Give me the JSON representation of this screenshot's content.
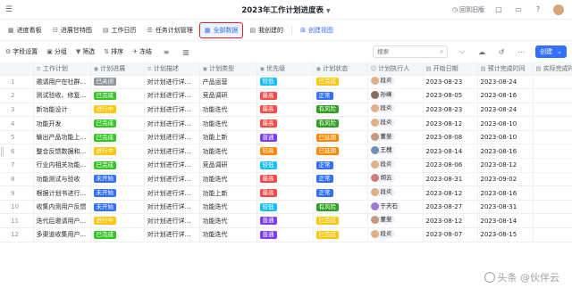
{
  "header": {
    "title": "2023年工作计划进度表",
    "back_label": "回到旧版"
  },
  "tabs": [
    {
      "label": "进度看板",
      "icon": "board-icon"
    },
    {
      "label": "进展甘特图",
      "icon": "gantt-icon"
    },
    {
      "label": "工作日历",
      "icon": "calendar-icon"
    },
    {
      "label": "任务计划管理",
      "icon": "list-icon"
    },
    {
      "label": "全部数据",
      "icon": "grid-icon",
      "active": true
    },
    {
      "label": "我创建的",
      "icon": "table-icon"
    },
    {
      "label": "创建视图",
      "icon": "plus-icon"
    }
  ],
  "toolbar": {
    "field_settings": "字段设置",
    "group": "分组",
    "filter": "筛选",
    "sort": "排序",
    "freeze": "冻结",
    "search_placeholder": "搜索",
    "create_label": "创建"
  },
  "table": {
    "columns": [
      "工作计划",
      "计划进展",
      "计划描述",
      "计划类型",
      "优先级",
      "计划状态",
      "计划执行人",
      "开始日期",
      "预计完成时间",
      "实际完成时"
    ],
    "rows": [
      {
        "idx": "1",
        "plan": "邀请用户在社群...",
        "progress": "已关闭",
        "desc": "对计划进行详细...",
        "type": "产品运营",
        "priority": "较低",
        "status": "已完成",
        "owner": "段炎",
        "start": "2023-08-23",
        "due": "2023-08-24",
        "actual": ""
      },
      {
        "idx": "2",
        "plan": "测试验收、修复...",
        "progress": "已完成",
        "desc": "对计划进行详细...",
        "type": "竞品调研",
        "priority": "最高",
        "status": "正常",
        "owner": "孙峰",
        "start": "2023-08-05",
        "due": "2023-08-16",
        "actual": ""
      },
      {
        "idx": "3",
        "plan": "新功能设计",
        "progress": "进行中",
        "desc": "对计划进行详细...",
        "type": "功能迭代",
        "priority": "最高",
        "status": "有风险",
        "owner": "段炎",
        "start": "2023-08-23",
        "due": "2023-08-24",
        "actual": ""
      },
      {
        "idx": "4",
        "plan": "功能开发",
        "progress": "已完成",
        "desc": "对计划进行详细...",
        "type": "功能迭代",
        "priority": "最高",
        "status": "有风险",
        "owner": "段炎",
        "start": "2023-08-12",
        "due": "2023-08-10",
        "actual": ""
      },
      {
        "idx": "5",
        "plan": "输出产品功能上...",
        "progress": "已完成",
        "desc": "对计划进行详细...",
        "type": "功能上新",
        "priority": "普通",
        "status": "已延期",
        "owner": "董斐",
        "start": "2023-08-08",
        "due": "2023-08-10",
        "actual": ""
      },
      {
        "idx": "6",
        "plan": "整合反馈数据和...",
        "progress": "进行中",
        "desc": "对计划进行详细...",
        "type": "功能迭代",
        "priority": "较高",
        "status": "已延期",
        "owner": "王槐",
        "start": "2023-08-14",
        "due": "2023-08-16",
        "actual": ""
      },
      {
        "idx": "7",
        "plan": "行业内相关功能...",
        "progress": "已完成",
        "desc": "对计划进行详细...",
        "type": "竞品调研",
        "priority": "较低",
        "status": "正常",
        "owner": "段炎",
        "start": "2023-08-06",
        "due": "2023-08-12",
        "actual": ""
      },
      {
        "idx": "8",
        "plan": "功能测试与验收",
        "progress": "未开始",
        "desc": "对计划进行详细...",
        "type": "功能迭代",
        "priority": "最高",
        "status": "正常",
        "owner": "胡云",
        "start": "2023-08-31",
        "due": "2023-09-02",
        "actual": ""
      },
      {
        "idx": "9",
        "plan": "根据计划书进行...",
        "progress": "未开始",
        "desc": "对计划进行详细...",
        "type": "功能上新",
        "priority": "最高",
        "status": "正常",
        "owner": "段炎",
        "start": "2023-08-12",
        "due": "2023-08-16",
        "actual": ""
      },
      {
        "idx": "10",
        "plan": "收集内测用户反馈",
        "progress": "未开始",
        "desc": "对计划进行详细...",
        "type": "功能迭代",
        "priority": "较低",
        "status": "有风险",
        "owner": "于天石",
        "start": "2023-08-27",
        "due": "2023-08-31",
        "actual": ""
      },
      {
        "idx": "11",
        "plan": "迭代后邀请用户...",
        "progress": "进行中",
        "desc": "对计划进行详细...",
        "type": "功能迭代",
        "priority": "普通",
        "status": "已完成",
        "owner": "董斐",
        "start": "2023-08-12",
        "due": "2023-08-14",
        "actual": ""
      },
      {
        "idx": "12",
        "plan": "多渠道收集用户...",
        "progress": "已完成",
        "desc": "对计划进行详细...",
        "type": "功能迭代",
        "priority": "普通",
        "status": "已完成",
        "owner": "段炎",
        "start": "2023-08-07",
        "due": "2023-08-15",
        "actual": ""
      }
    ]
  },
  "colors": {
    "accent": "#3370ff",
    "progress": {
      "已关闭": "#8f959e",
      "已完成": "#34c724",
      "进行中": "#ffc60a",
      "未开始": "#3370ff"
    },
    "priority": {
      "较低": "#14c0ff",
      "最高": "#f54a45",
      "普通": "#7f3bf5",
      "较高": "#ff8800"
    },
    "status": {
      "已完成": "#ffc60a",
      "正常": "#3370ff",
      "有风险": "#2ea121",
      "已延期": "#ff8800"
    },
    "owners": {
      "段炎": "#e0b08a",
      "孙峰": "#8a6f5a",
      "董斐": "#c49a7a",
      "王槐": "#6d8fb5",
      "胡云": "#d07a7a",
      "于天石": "#a07ad0"
    }
  },
  "watermark": "头条 @伙伴云"
}
